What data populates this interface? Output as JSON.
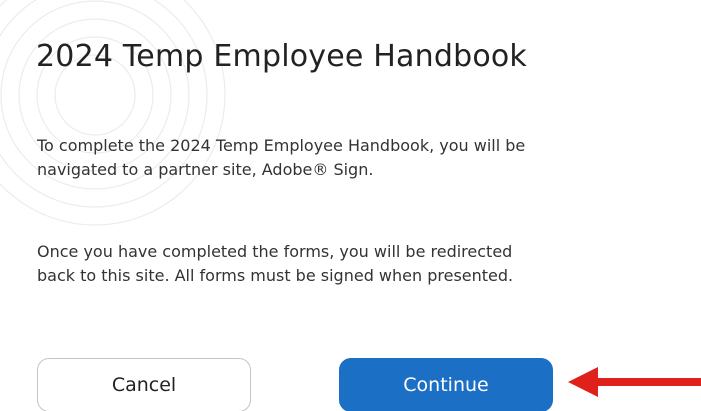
{
  "dialog": {
    "title": "2024 Temp Employee Handbook",
    "paragraph_1": "To complete the 2024 Temp Employee Handbook, you will be navigated to a partner site, Adobe® Sign.",
    "paragraph_2": "Once you have completed the forms, you will be redirected back to this site. All forms must be signed when presented."
  },
  "buttons": {
    "cancel_label": "Cancel",
    "continue_label": "Continue"
  },
  "colors": {
    "primary_button": "#1b6fc4",
    "annotation_arrow": "#e0201b",
    "background": "#ffffff"
  },
  "icons": {
    "annotation": "arrow-left-icon"
  }
}
